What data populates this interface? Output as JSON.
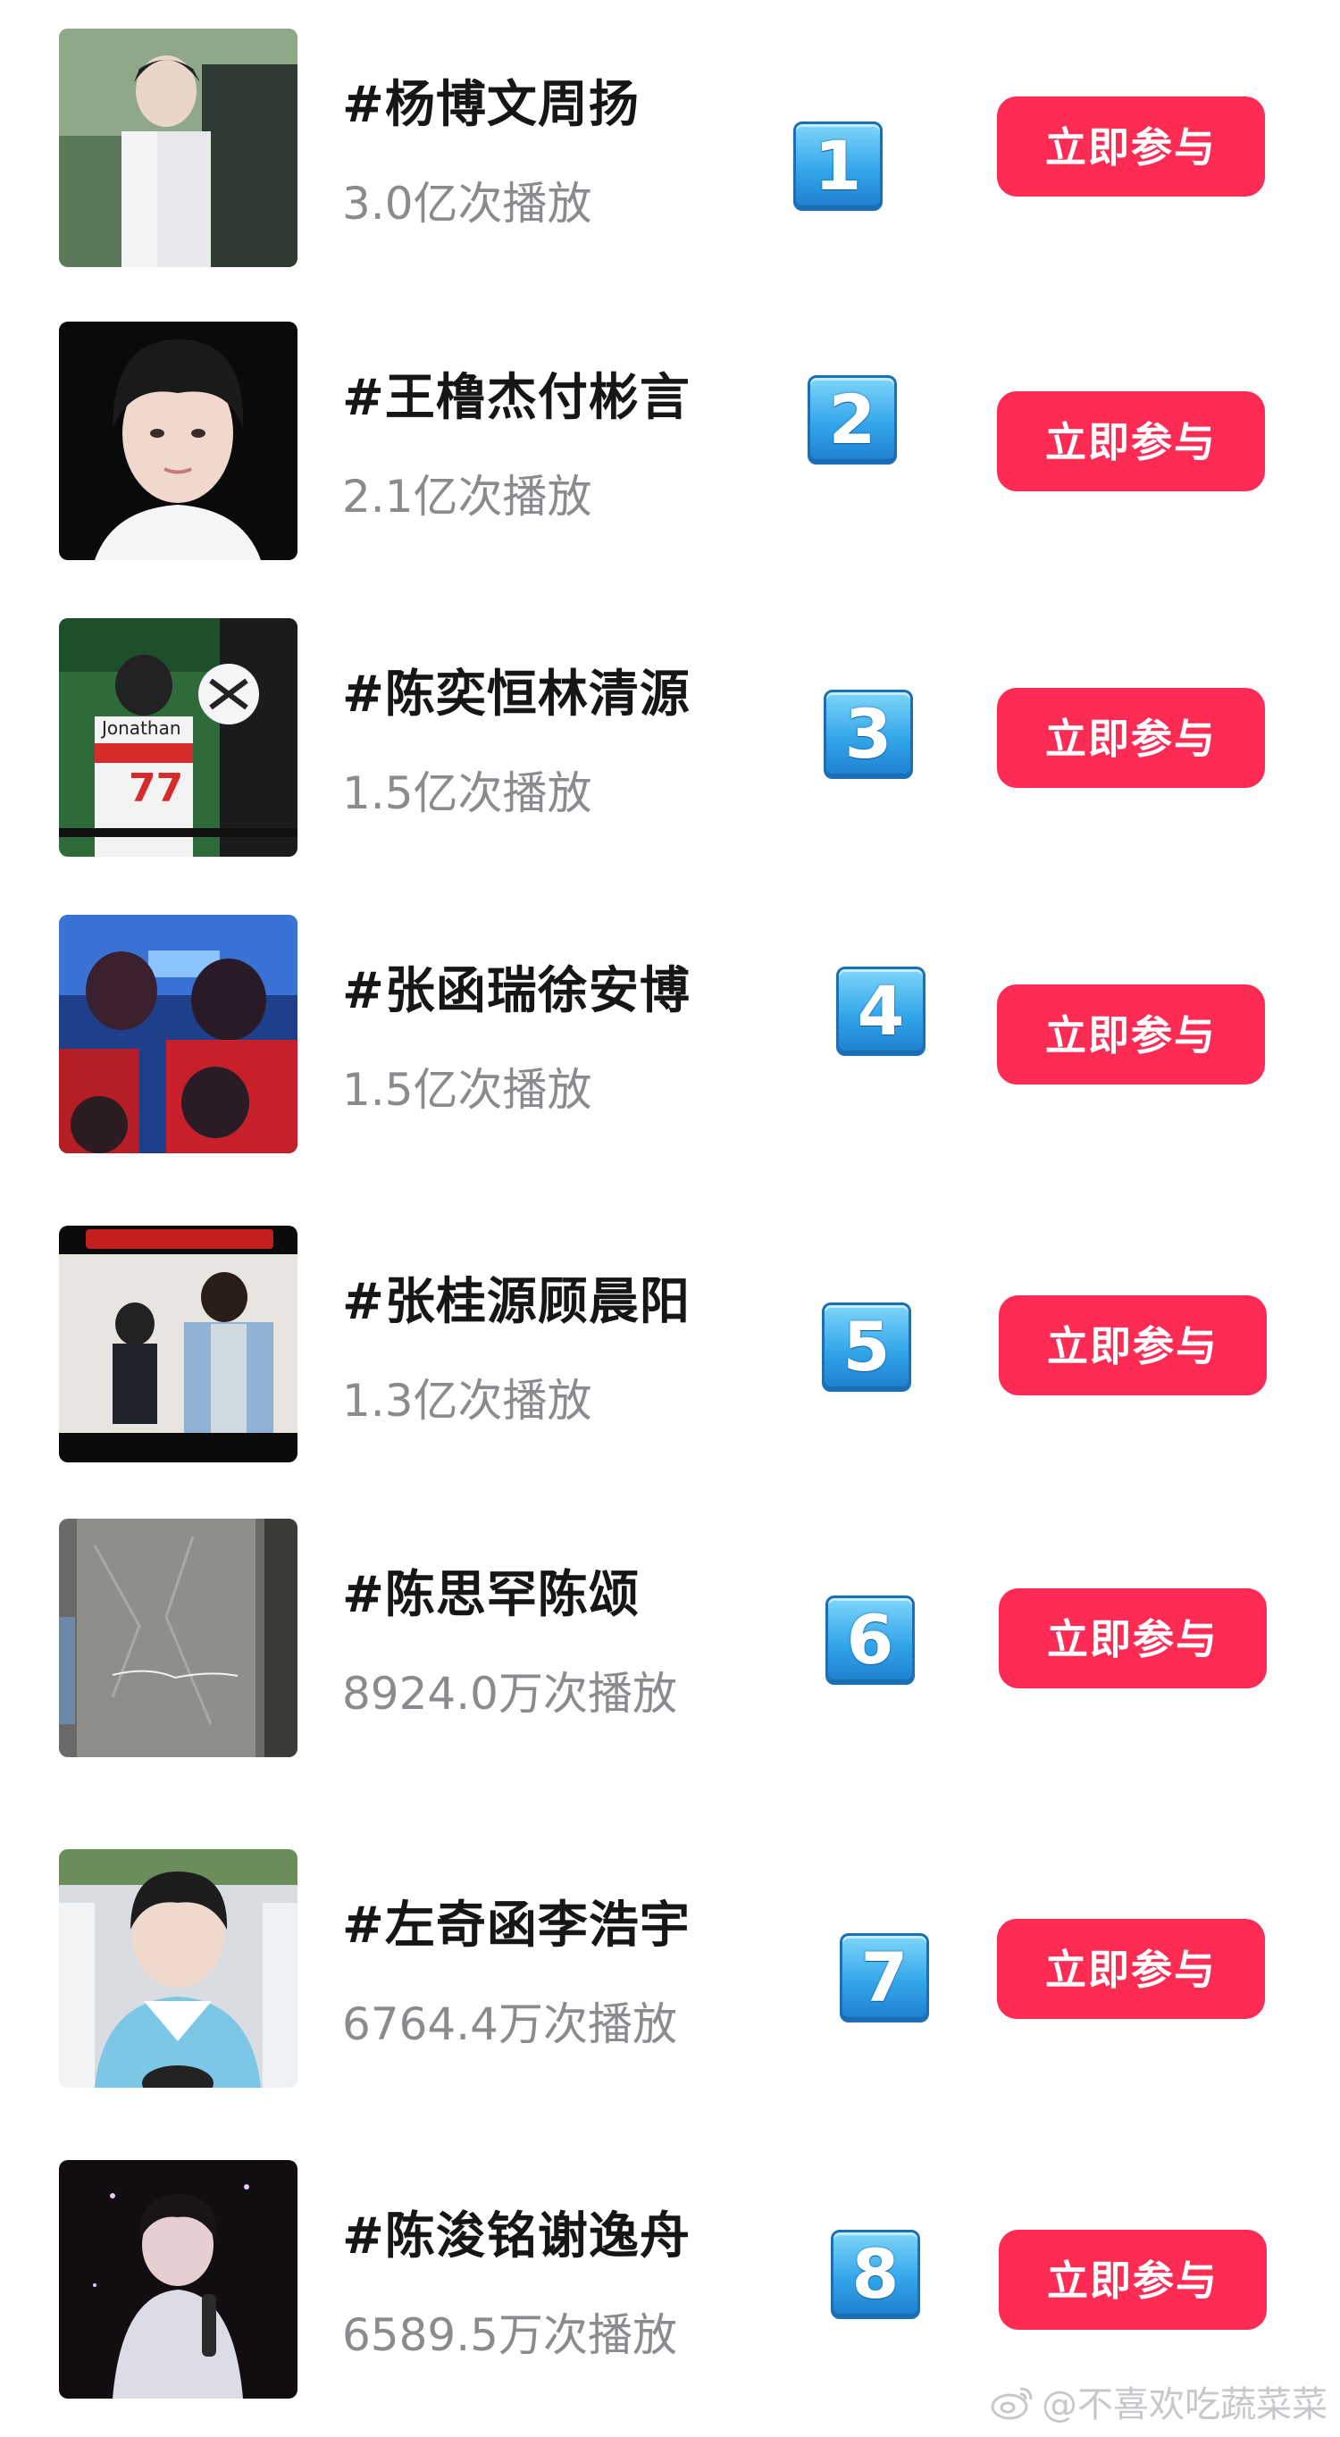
{
  "topics": [
    {
      "rank": "1",
      "title": "#杨博文周扬",
      "plays": "3.0亿次播放",
      "button": "立即参与"
    },
    {
      "rank": "2",
      "title": "#王橹杰付彬言",
      "plays": "2.1亿次播放",
      "button": "立即参与"
    },
    {
      "rank": "3",
      "title": "#陈奕恒林清源",
      "plays": "1.5亿次播放",
      "button": "立即参与"
    },
    {
      "rank": "4",
      "title": "#张函瑞徐安博",
      "plays": "1.5亿次播放",
      "button": "立即参与"
    },
    {
      "rank": "5",
      "title": "#张桂源顾晨阳",
      "plays": "1.3亿次播放",
      "button": "立即参与"
    },
    {
      "rank": "6",
      "title": "#陈思罕陈颂",
      "plays": "8924.0万次播放",
      "button": "立即参与"
    },
    {
      "rank": "7",
      "title": "#左奇函李浩宇",
      "plays": "6764.4万次播放",
      "button": "立即参与"
    },
    {
      "rank": "8",
      "title": "#陈浚铭谢逸舟",
      "plays": "6589.5万次播放",
      "button": "立即参与"
    }
  ],
  "thumb_overlays": {
    "jersey_name": "Jonathan",
    "jersey_number": "77"
  },
  "watermark": "@不喜欢吃蔬菜菜",
  "colors": {
    "button_bg": "#fe2c55",
    "button_text": "#ffffff",
    "title_text": "#161616",
    "plays_text": "#8a8a8f",
    "rank_badge": "#33a6ea"
  }
}
